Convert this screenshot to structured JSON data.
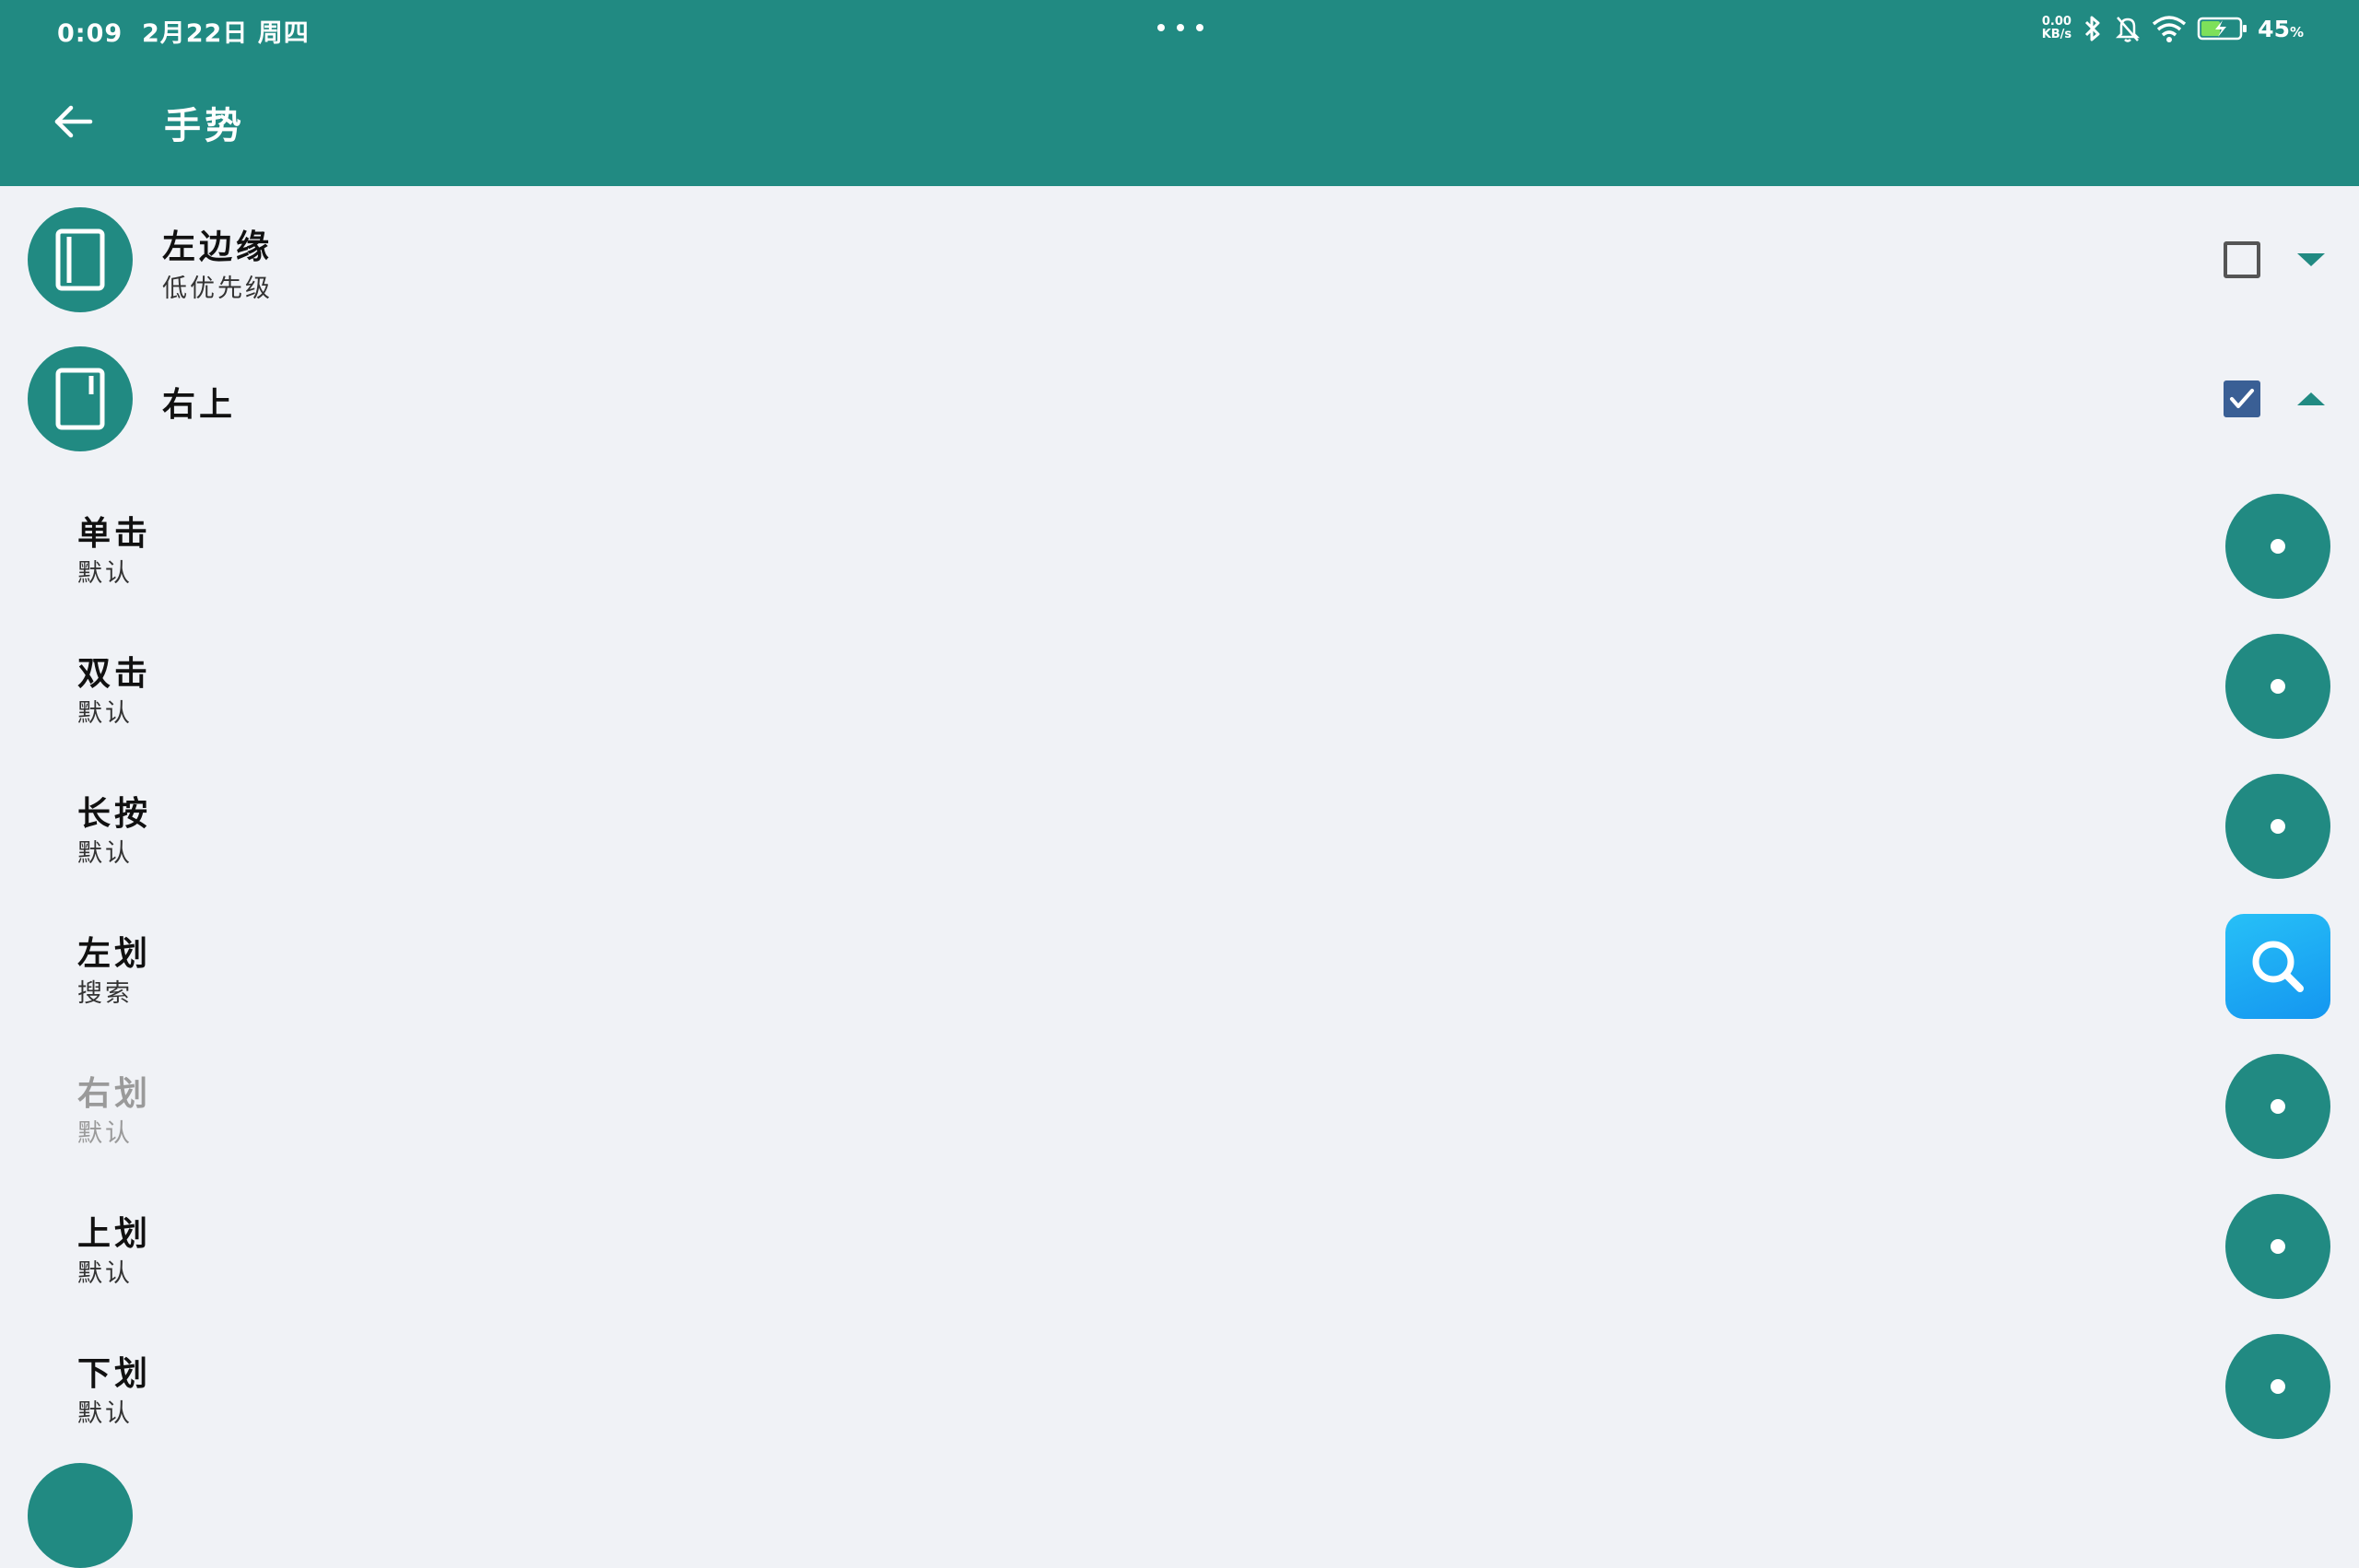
{
  "status": {
    "time": "0:09",
    "date": "2月22日 周四",
    "net_speed_top": "0.00",
    "net_speed_bottom": "KB/s",
    "battery_percent": "45",
    "battery_unit": "%"
  },
  "appbar": {
    "title": "手势"
  },
  "sections": [
    {
      "title": "左边缘",
      "subtitle": "低优先级",
      "checked": false,
      "expanded": false
    },
    {
      "title": "右上",
      "subtitle": "",
      "checked": true,
      "expanded": true
    }
  ],
  "gestures": [
    {
      "label": "单击",
      "value": "默认",
      "action_icon": "dot-icon",
      "enabled": true
    },
    {
      "label": "双击",
      "value": "默认",
      "action_icon": "dot-icon",
      "enabled": true
    },
    {
      "label": "长按",
      "value": "默认",
      "action_icon": "dot-icon",
      "enabled": true
    },
    {
      "label": "左划",
      "value": "搜索",
      "action_icon": "search-icon",
      "enabled": true
    },
    {
      "label": "右划",
      "value": "默认",
      "action_icon": "dot-icon",
      "enabled": false
    },
    {
      "label": "上划",
      "value": "默认",
      "action_icon": "dot-icon",
      "enabled": true
    },
    {
      "label": "下划",
      "value": "默认",
      "action_icon": "dot-icon",
      "enabled": true
    }
  ],
  "colors": {
    "primary": "#218a82",
    "background": "#f0f2f6",
    "checkbox_checked": "#3a5f95",
    "search_icon_bg": "#1ba6f3"
  }
}
